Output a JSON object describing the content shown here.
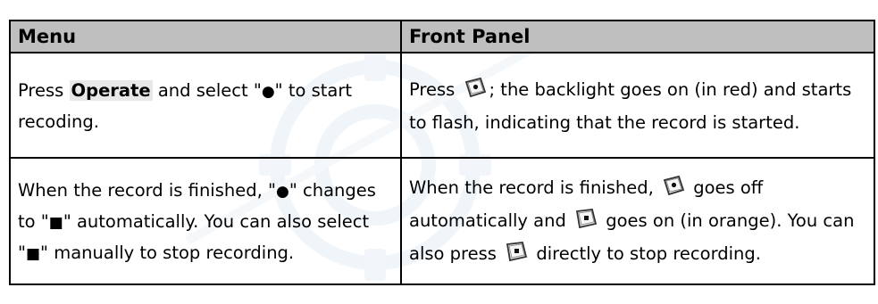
{
  "headers": {
    "menu": "Menu",
    "front_panel": "Front Panel"
  },
  "row1": {
    "menu": {
      "press": "Press ",
      "operate": "Operate",
      "select": " and select \"",
      "record_glyph": "●",
      "end": "\" to start recoding."
    },
    "front": {
      "press": "Press ",
      "rest": "; the backlight goes on (in red) and starts to flash, indicating that the record is started."
    }
  },
  "row2": {
    "menu": {
      "a": "When the record is finished, \"",
      "record_glyph": "●",
      "b": "\" changes to \"",
      "stop_glyph": "■",
      "c": "\" automatically. You can also select \"",
      "stop_glyph_2": "■",
      "d": "\" manually to stop recording."
    },
    "front": {
      "a": "When the record is finished, ",
      "b": " goes off automatically and ",
      "c": " goes on (in orange). You can also press ",
      "d": " directly to stop recording."
    }
  },
  "icons": {
    "record_button": "record-button-icon",
    "stop_button": "stop-button-icon"
  }
}
